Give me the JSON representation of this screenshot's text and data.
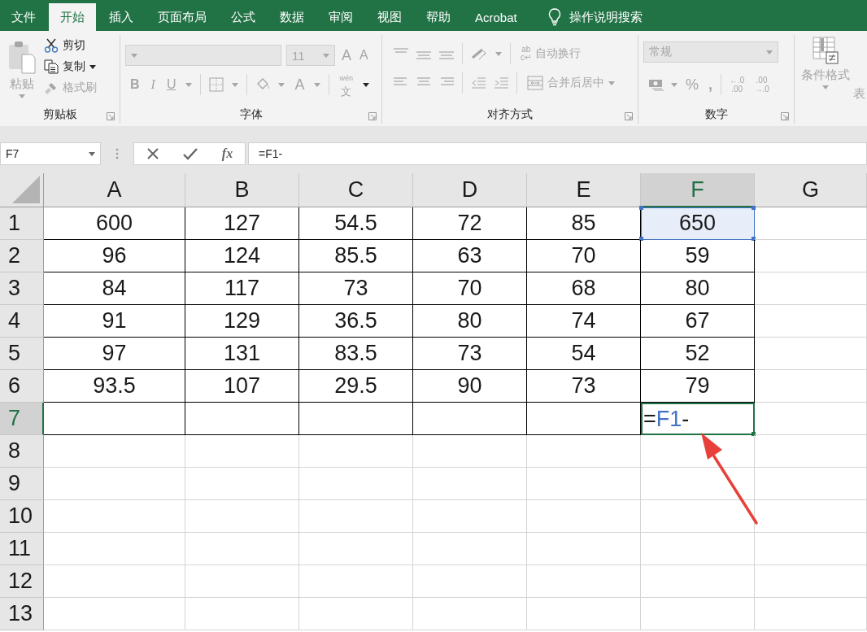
{
  "menu_tabs": [
    {
      "label": "文件",
      "selected": false
    },
    {
      "label": "开始",
      "selected": true
    },
    {
      "label": "插入",
      "selected": false
    },
    {
      "label": "页面布局",
      "selected": false
    },
    {
      "label": "公式",
      "selected": false
    },
    {
      "label": "数据",
      "selected": false
    },
    {
      "label": "审阅",
      "selected": false
    },
    {
      "label": "视图",
      "selected": false
    },
    {
      "label": "帮助",
      "selected": false
    },
    {
      "label": "Acrobat",
      "selected": false
    }
  ],
  "tell_me": "操作说明搜索",
  "ribbon": {
    "disabled": true,
    "clipboard": {
      "title": "剪贴板",
      "paste": {
        "label": "粘贴",
        "disabled": true
      },
      "items": [
        {
          "kind": "cut",
          "label": "剪切",
          "disabled": false
        },
        {
          "kind": "copy",
          "label": "复制",
          "disabled": false
        },
        {
          "kind": "format_painter",
          "label": "格式刷",
          "disabled": true
        }
      ]
    },
    "font": {
      "title": "字体",
      "size": "11",
      "grow": "A",
      "shrink": "A",
      "styles": [
        "B",
        "I",
        "U"
      ],
      "font_color": "A",
      "phonetic": {
        "top": "wén",
        "bottom": "文"
      }
    },
    "alignment": {
      "title": "对齐方式",
      "wrap": {
        "icon_lines": [
          "ab",
          "c↵"
        ],
        "label": "自动换行"
      },
      "merge": "合并后居中"
    },
    "number": {
      "title": "数字",
      "format": "常规",
      "percent": "%",
      "comma": ",",
      "decimals": [
        {
          "lines": [
            "←.0",
            ".00"
          ]
        },
        {
          "lines": [
            ".00",
            "→.0"
          ]
        }
      ]
    },
    "styles": {
      "conditional": "条件格式",
      "next_cut": "表"
    }
  },
  "formula_bar": {
    "name_box": "F7",
    "fx": "fx",
    "formula": "=F1-"
  },
  "sheet": {
    "columns": [
      {
        "label": "A",
        "selected": false
      },
      {
        "label": "B",
        "selected": false
      },
      {
        "label": "C",
        "selected": false
      },
      {
        "label": "D",
        "selected": false
      },
      {
        "label": "E",
        "selected": false
      },
      {
        "label": "F",
        "selected": true
      },
      {
        "label": "G",
        "selected": false
      }
    ],
    "rows": [
      {
        "label": "1",
        "selected": false,
        "bordered": true,
        "referenced": true,
        "cells": [
          "600",
          "127",
          "54.5",
          "72",
          "85",
          "650"
        ]
      },
      {
        "label": "2",
        "selected": false,
        "bordered": true,
        "cells": [
          "96",
          "124",
          "85.5",
          "63",
          "70",
          "59"
        ]
      },
      {
        "label": "3",
        "selected": false,
        "bordered": true,
        "cells": [
          "84",
          "117",
          "73",
          "70",
          "68",
          "80"
        ]
      },
      {
        "label": "4",
        "selected": false,
        "bordered": true,
        "cells": [
          "91",
          "129",
          "36.5",
          "80",
          "74",
          "67"
        ]
      },
      {
        "label": "5",
        "selected": false,
        "bordered": true,
        "cells": [
          "97",
          "131",
          "83.5",
          "73",
          "54",
          "52"
        ]
      },
      {
        "label": "6",
        "selected": false,
        "bordered": true,
        "cells": [
          "93.5",
          "107",
          "29.5",
          "90",
          "73",
          "79"
        ]
      },
      {
        "label": "7",
        "selected": true,
        "bordered": true,
        "editing": [
          {
            "kind": "text",
            "text": "="
          },
          {
            "kind": "ref",
            "text": "F1"
          },
          {
            "kind": "text",
            "text": "-"
          }
        ]
      },
      {
        "label": "8",
        "selected": false,
        "bordered": false
      },
      {
        "label": "9",
        "selected": false,
        "bordered": false
      },
      {
        "label": "10",
        "selected": false,
        "bordered": false
      },
      {
        "label": "11",
        "selected": false,
        "bordered": false
      },
      {
        "label": "12",
        "selected": false,
        "bordered": false
      },
      {
        "label": "13",
        "selected": false,
        "bordered": false
      }
    ],
    "pointer_arrow": true
  }
}
